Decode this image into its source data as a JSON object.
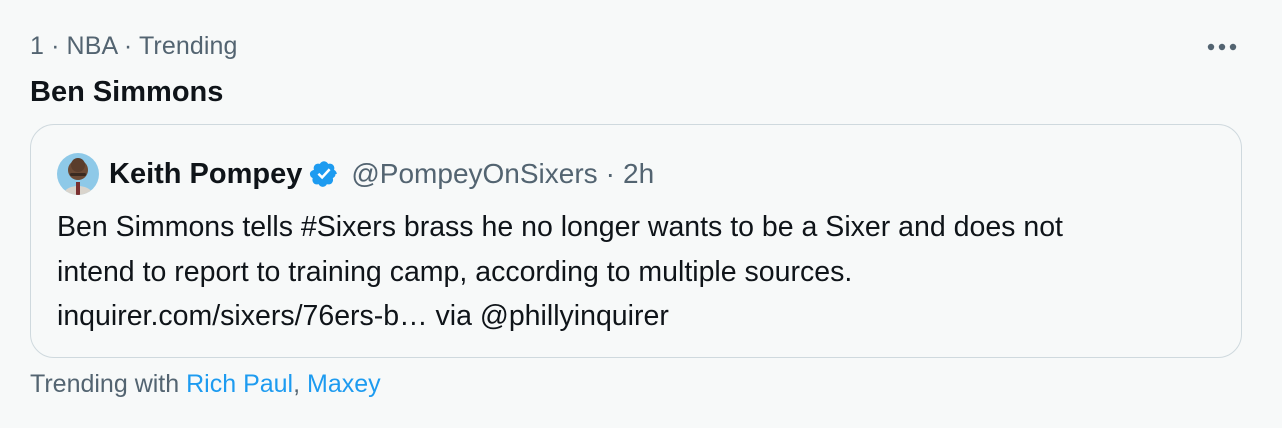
{
  "trend": {
    "rank": "1",
    "separator": "·",
    "category": "NBA",
    "status": "Trending",
    "title": "Ben Simmons"
  },
  "quote": {
    "author_name": "Keith Pompey",
    "handle": "@PompeyOnSixers",
    "separator": "·",
    "time": "2h",
    "verified": true,
    "body_lines": [
      "Ben Simmons tells #Sixers brass he no longer wants to be a Sixer and does not",
      "intend to report to training camp, according to multiple sources.",
      "inquirer.com/sixers/76ers-b… via @phillyinquirer"
    ]
  },
  "trending_with": {
    "label": "Trending with",
    "items": [
      "Rich Paul",
      "Maxey"
    ],
    "separator": ","
  },
  "icons": {
    "more": "more-horizontal-icon",
    "verified": "verified-badge-icon"
  },
  "colors": {
    "text_primary": "#0f1419",
    "text_secondary": "#536471",
    "link": "#1d9bf0",
    "verified": "#1d9bf0",
    "background": "#f7f9f9",
    "border": "#cfd9de"
  }
}
